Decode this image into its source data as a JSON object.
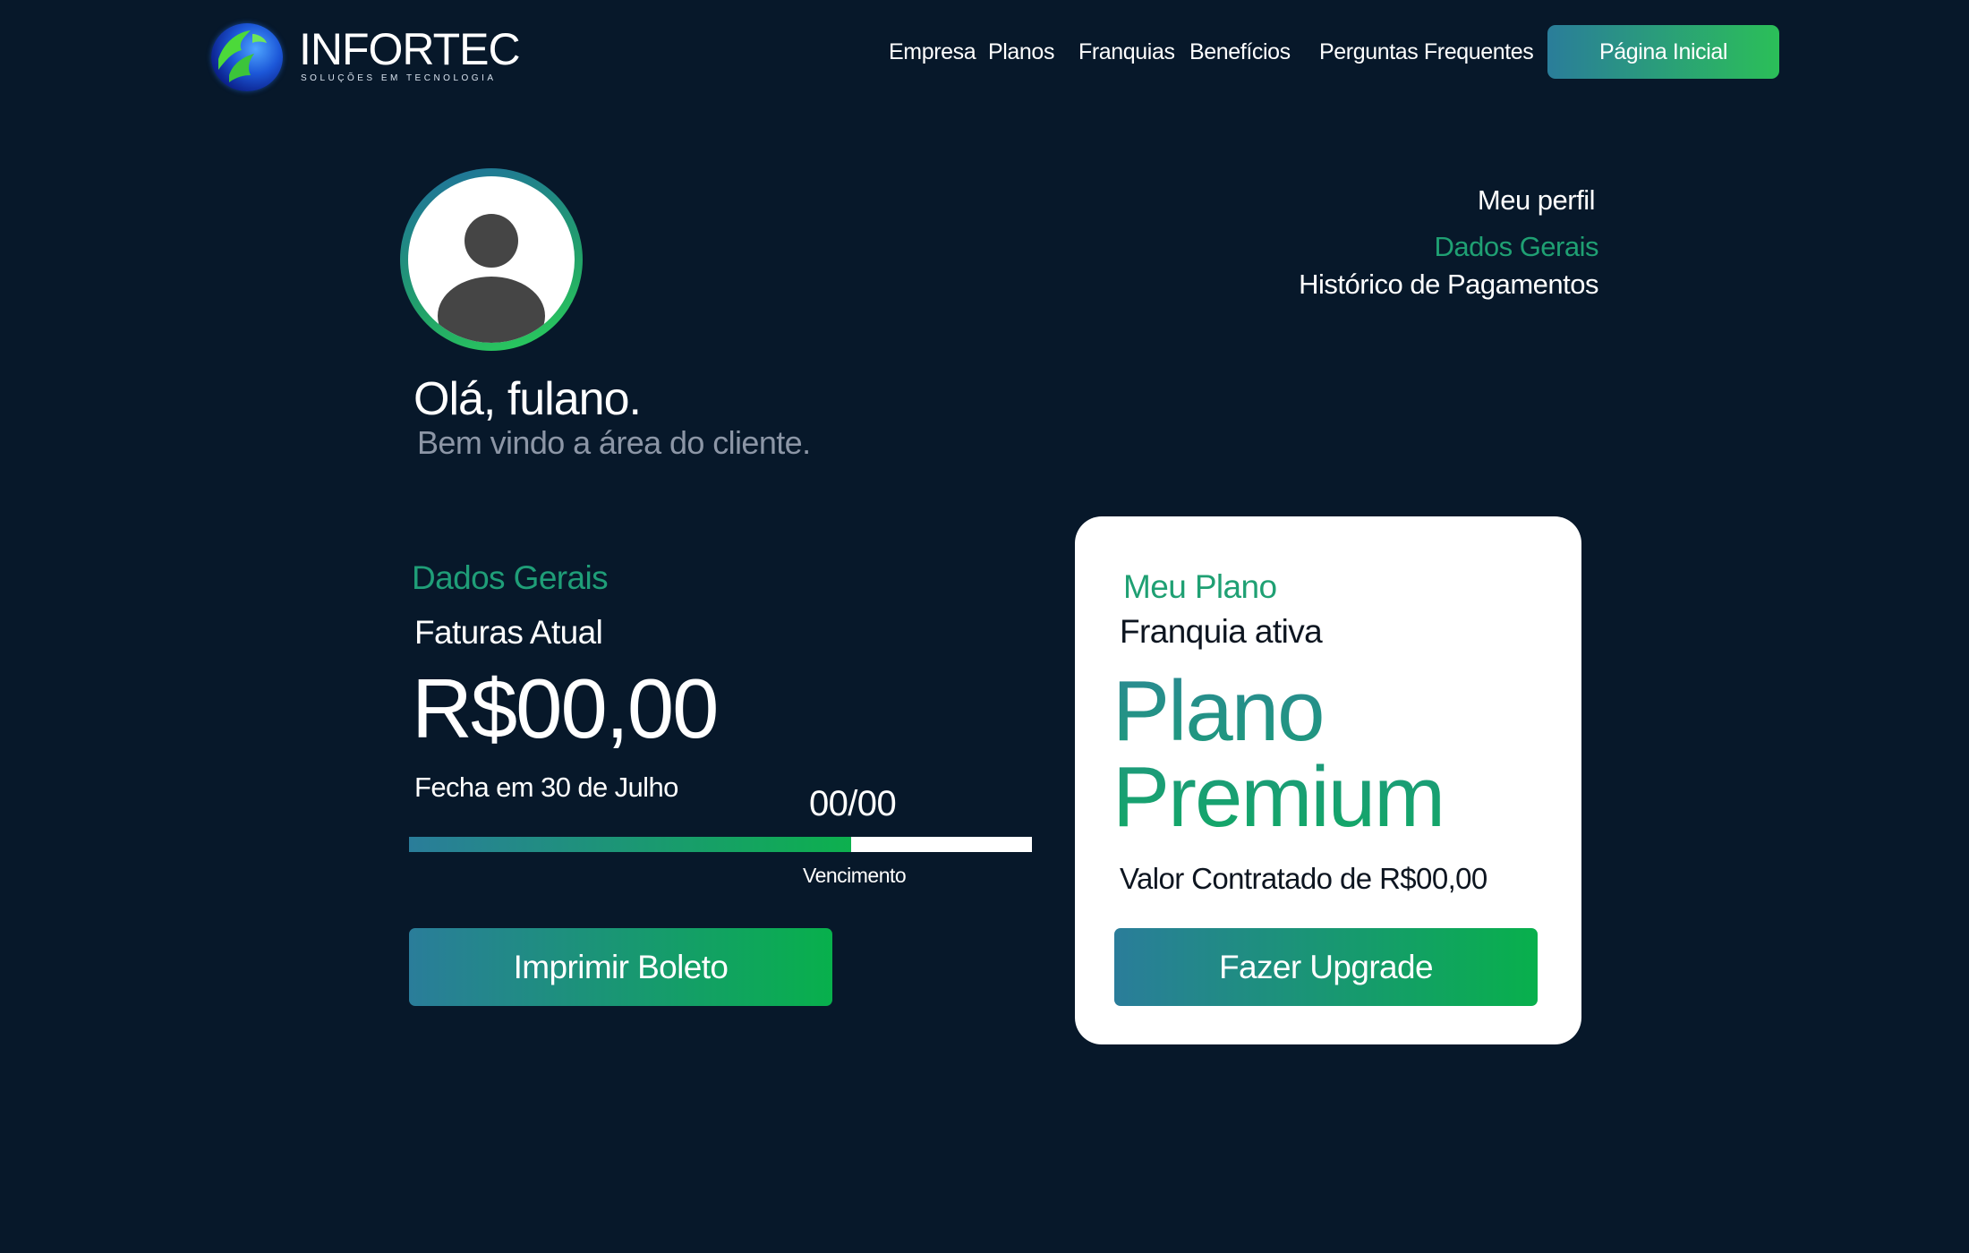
{
  "header": {
    "brand": "INFORTEC",
    "tagline": "SOLUÇÕES EM TECNOLOGIA",
    "nav": [
      "Empresa",
      "Planos",
      "Franquias",
      "Benefícios",
      "Perguntas Frequentes"
    ],
    "home_button": "Página Inicial"
  },
  "profile": {
    "greeting": "Olá, fulano.",
    "welcome": "Bem vindo a área do cliente."
  },
  "side_menu": {
    "title": "Meu perfil",
    "items": [
      "Dados Gerais",
      "Histórico de Pagamentos"
    ],
    "active_color": "#1fa073"
  },
  "dados_gerais": {
    "title": "Dados Gerais",
    "subtitle": "Faturas Atual",
    "amount": "R$00,00",
    "closing": "Fecha em 30 de Julho",
    "count": "00/00",
    "progress_fraction": 0.71,
    "due_label": "Vencimento",
    "print_button": "Imprimir Boleto"
  },
  "plan_card": {
    "title": "Meu Plano",
    "subtitle": "Franquia ativa",
    "plan_line1": "Plano",
    "plan_line2": "Premium",
    "contracted": "Valor Contratado de R$00,00",
    "upgrade_button": "Fazer Upgrade"
  },
  "colors": {
    "background": "#07182a",
    "accent_teal": "#2a7d9a",
    "accent_green": "#08b04c"
  }
}
